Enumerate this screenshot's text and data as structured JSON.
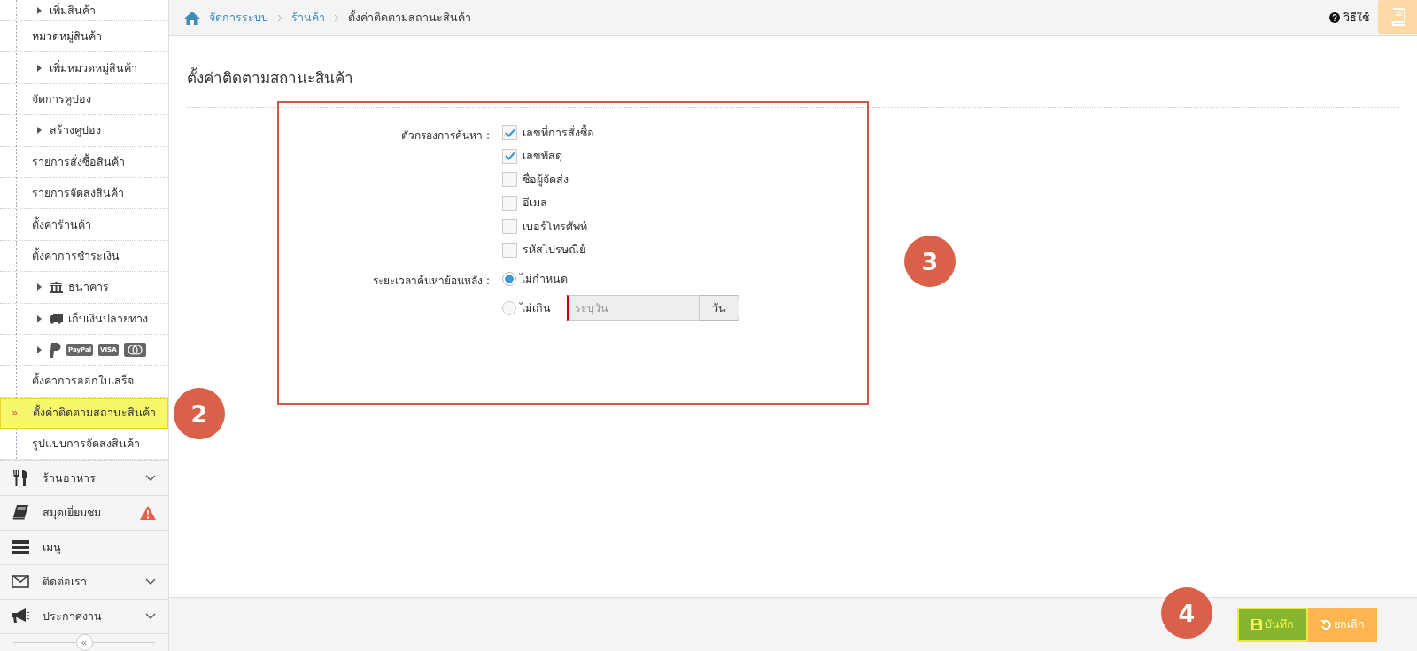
{
  "sidebar": {
    "tree": [
      {
        "children": [
          {
            "label": "เพิ่มสินค้า",
            "selected": false
          }
        ]
      },
      {
        "label": "หมวดหมู่สินค้า",
        "selected": false,
        "children": [
          {
            "label": "เพิ่มหมวดหมู่สินค้า",
            "selected": false
          }
        ]
      },
      {
        "label": "จัดการคูปอง",
        "selected": false,
        "children": [
          {
            "label": "สร้างคูปอง",
            "selected": false
          }
        ]
      },
      {
        "label": "รายการสั่งซื้อสินค้า",
        "selected": false
      },
      {
        "label": "รายการจัดส่งสินค้า",
        "selected": false
      },
      {
        "label": "ตั้งค่าร้านค้า",
        "selected": false
      },
      {
        "label": "ตั้งค่าการชำระเงิน",
        "selected": false,
        "children": [
          {
            "kind": "bank",
            "label": "ธนาคาร",
            "selected": false
          },
          {
            "kind": "cod",
            "label": "เก็บเงินปลายทาง",
            "selected": false
          },
          {
            "kind": "cards",
            "logos": [
              "PayPal",
              "VISA"
            ],
            "selected": false
          }
        ]
      },
      {
        "label": "ตั้งค่าการออกใบเสร็จ",
        "selected": false
      },
      {
        "label": "ตั้งค่าติดตามสถานะสินค้า",
        "selected": true,
        "marker": "»"
      },
      {
        "label": "รูปแบบการจัดส่งสินค้า",
        "selected": false
      }
    ],
    "menus": [
      {
        "kind": "utensils",
        "label": "ร้านอาหาร",
        "has_submenu": true,
        "alert": false
      },
      {
        "kind": "book",
        "label": "สมุดเยี่ยมชม",
        "has_submenu": false,
        "alert": true
      },
      {
        "kind": "list",
        "label": "เมนู",
        "has_submenu": false,
        "alert": false
      },
      {
        "kind": "envelope",
        "label": "ติดต่อเรา",
        "has_submenu": true,
        "alert": false
      },
      {
        "kind": "megaphone",
        "label": "ประกาศงาน",
        "has_submenu": true,
        "alert": false
      }
    ],
    "collapse": "«"
  },
  "breadcrumb": [
    {
      "label": "จัดการระบบ",
      "link": true
    },
    {
      "label": "ร้านค้า",
      "link": true
    },
    {
      "label": "ตั้งค่าติดตามสถานะสินค้า",
      "link": false
    }
  ],
  "help": "วิธีใช้",
  "page_title": "ตั้งค่าติดตามสถานะสินค้า",
  "filters": {
    "label": "ตัวกรองการค้นหา :",
    "options": [
      {
        "label": "เลขที่การสั่งซื้อ",
        "checked": true
      },
      {
        "label": "เลขพัสดุ",
        "checked": true
      },
      {
        "label": "ชื่อผู้จัดส่ง",
        "checked": false
      },
      {
        "label": "อีเมล",
        "checked": false
      },
      {
        "label": "เบอร์โทรศัพท์",
        "checked": false
      },
      {
        "label": "รหัสไปรษณีย์",
        "checked": false
      }
    ]
  },
  "lookback": {
    "label": "ระยะเวลาค้นหาย้อนหลัง :",
    "options": [
      {
        "label": "ไม่กำหนด",
        "selected": true
      },
      {
        "label": "ไม่เกิน",
        "selected": false,
        "placeholder": "ระบุวัน",
        "unit": "วัน"
      }
    ]
  },
  "buttons": [
    {
      "kind": "save",
      "label": "บันทึก"
    },
    {
      "kind": "cancel",
      "label": "ยกเลิก"
    }
  ],
  "steps": [
    "2",
    "3",
    "4"
  ]
}
